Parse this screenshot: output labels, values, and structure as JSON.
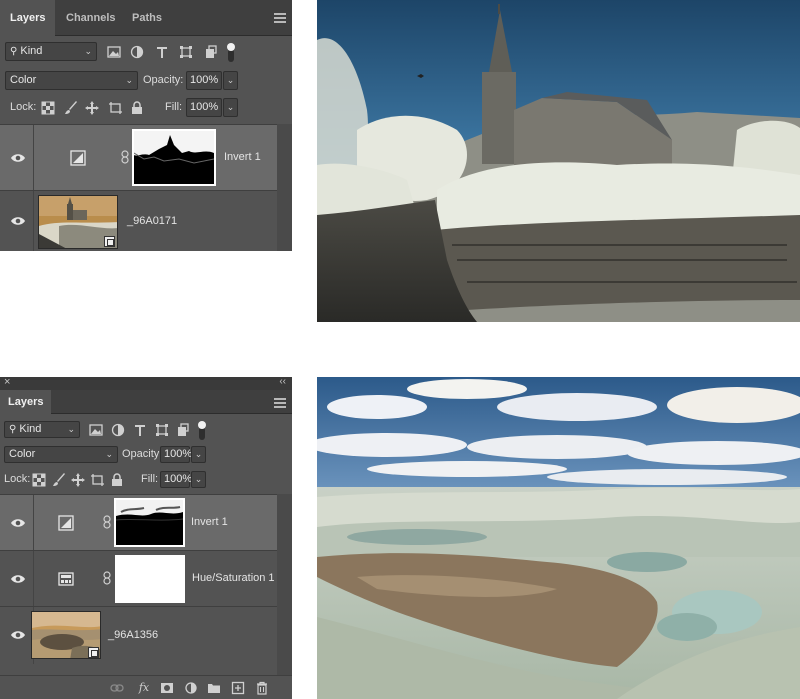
{
  "panel1": {
    "tabs": [
      {
        "label": "Layers",
        "active": true
      },
      {
        "label": "Channels",
        "active": false
      },
      {
        "label": "Paths",
        "active": false
      }
    ],
    "filter": {
      "label": "Kind"
    },
    "blend_mode": "Color",
    "opacity_label": "Opacity:",
    "opacity_value": "100%",
    "lock_label": "Lock:",
    "fill_label": "Fill:",
    "fill_value": "100%",
    "layers": [
      {
        "name": "Invert 1",
        "type": "adjustment",
        "selected": true
      },
      {
        "name": "_96A0171",
        "type": "smart-object",
        "selected": false
      }
    ]
  },
  "panel2": {
    "close_glyph": "×",
    "collapse_glyph": "‹‹",
    "tabs": [
      {
        "label": "Layers",
        "active": true
      }
    ],
    "filter": {
      "label": "Kind"
    },
    "blend_mode": "Color",
    "opacity_label": "Opacity:",
    "opacity_value": "100%",
    "lock_label": "Lock:",
    "fill_label": "Fill:",
    "fill_value": "100%",
    "layers": [
      {
        "name": "Invert 1",
        "type": "adjustment",
        "selected": true
      },
      {
        "name": "Hue/Saturation 1",
        "type": "adjustment",
        "selected": false
      },
      {
        "name": "_96A1356",
        "type": "smart-object",
        "selected": false
      }
    ],
    "footer_icons": [
      "link-icon",
      "fx-icon",
      "mask-icon",
      "adjustment-icon",
      "folder-icon",
      "new-layer-icon",
      "trash-icon"
    ],
    "fx_label": "fx"
  },
  "colors": {
    "panel_bg": "#535353",
    "tab_bar": "#3f3f3f",
    "selected_layer": "#6a6a6a",
    "field_bg": "#454545"
  }
}
